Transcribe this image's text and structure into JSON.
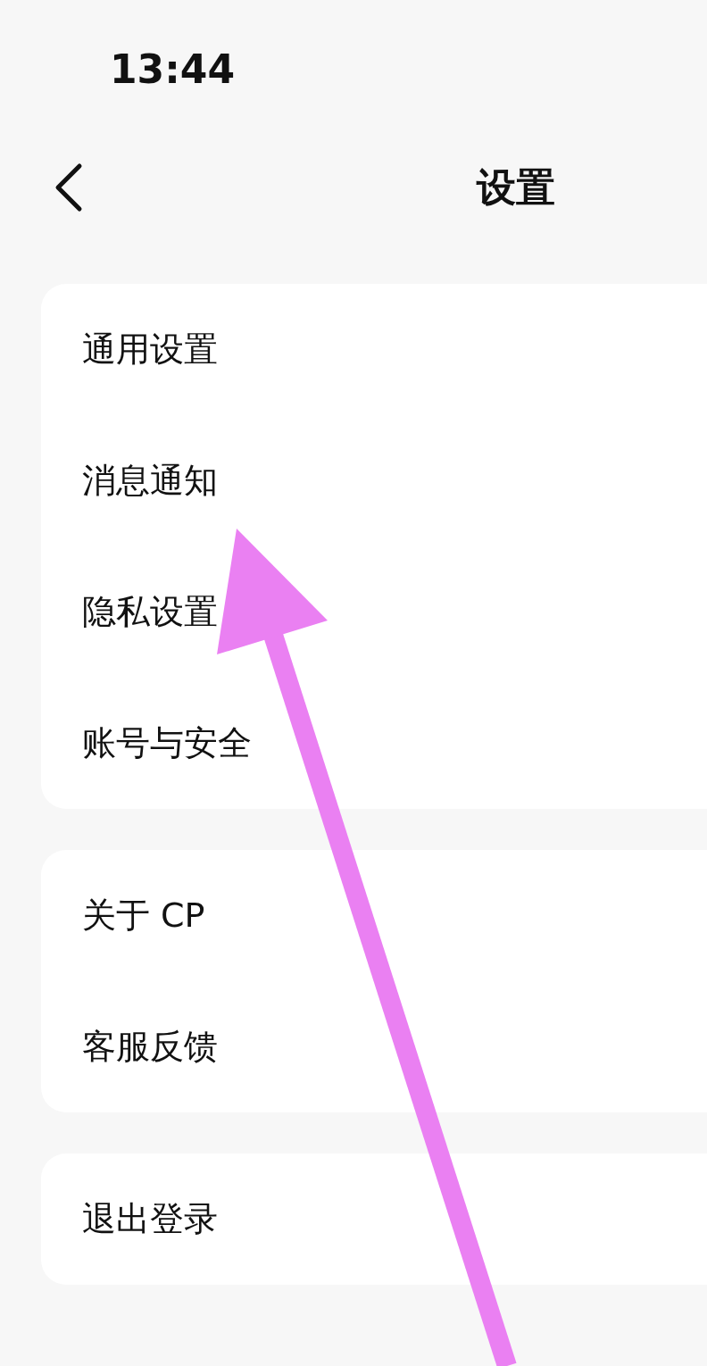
{
  "status_bar": {
    "time": "13:44"
  },
  "header": {
    "title": "设置"
  },
  "groups": [
    {
      "items": [
        {
          "label": "通用设置"
        },
        {
          "label": "消息通知"
        },
        {
          "label": "隐私设置"
        },
        {
          "label": "账号与安全"
        }
      ]
    },
    {
      "items": [
        {
          "label": "关于 CP"
        },
        {
          "label": "客服反馈"
        }
      ]
    },
    {
      "items": [
        {
          "label": "退出登录"
        }
      ]
    }
  ]
}
